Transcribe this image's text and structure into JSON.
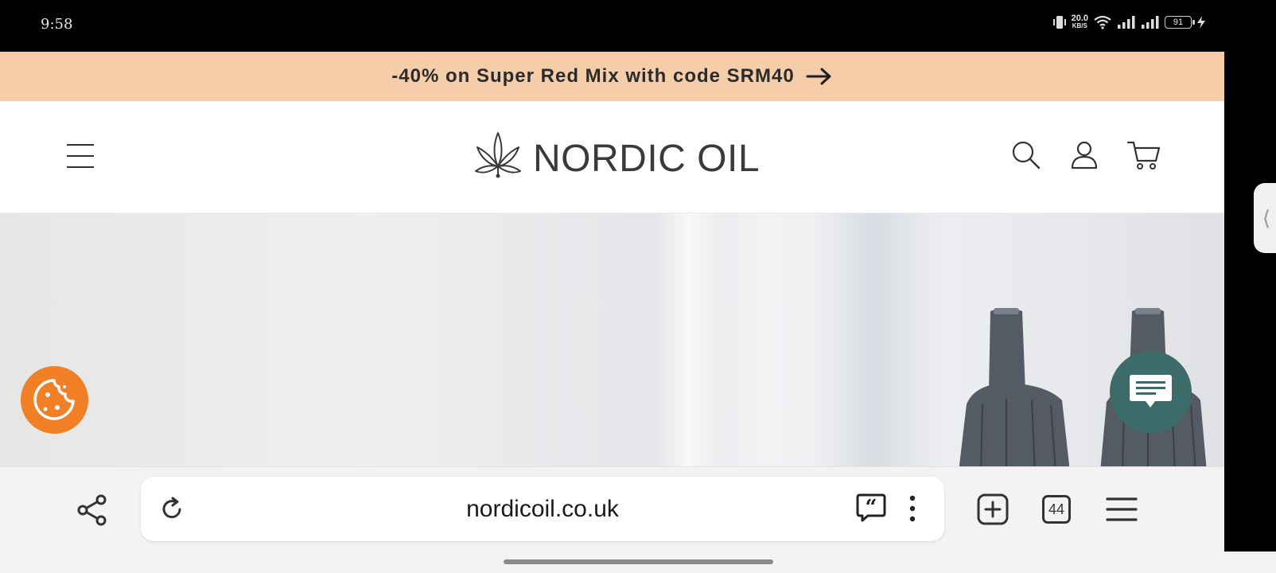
{
  "status_bar": {
    "time": "9:58",
    "net_speed": "20.0",
    "net_unit": "KB/S",
    "battery": "91",
    "icons": [
      "vibrate-icon",
      "wifi-icon",
      "signal-icon",
      "signal-icon",
      "battery-icon",
      "charging-icon"
    ]
  },
  "promo": {
    "text": "-40% on Super Red Mix with code SRM40",
    "icon": "arrow-right-icon"
  },
  "header": {
    "logo_text": "NORDIC OIL",
    "icons": [
      "menu-icon",
      "search-icon",
      "account-icon",
      "cart-icon"
    ]
  },
  "floating": {
    "cookie_icon": "cookie-icon",
    "chat_icon": "chat-icon",
    "accent_orange": "#f07f26",
    "accent_teal": "#3d6b6a"
  },
  "browser": {
    "url": "nordicoil.co.uk",
    "tab_count": "44",
    "icons": [
      "share-icon",
      "reload-icon",
      "quote-icon",
      "more-icon",
      "new-tab-icon",
      "tabs-icon",
      "menu-icon"
    ]
  },
  "colors": {
    "promo_bg": "#f5cda9",
    "page_bg": "#ffffff"
  }
}
